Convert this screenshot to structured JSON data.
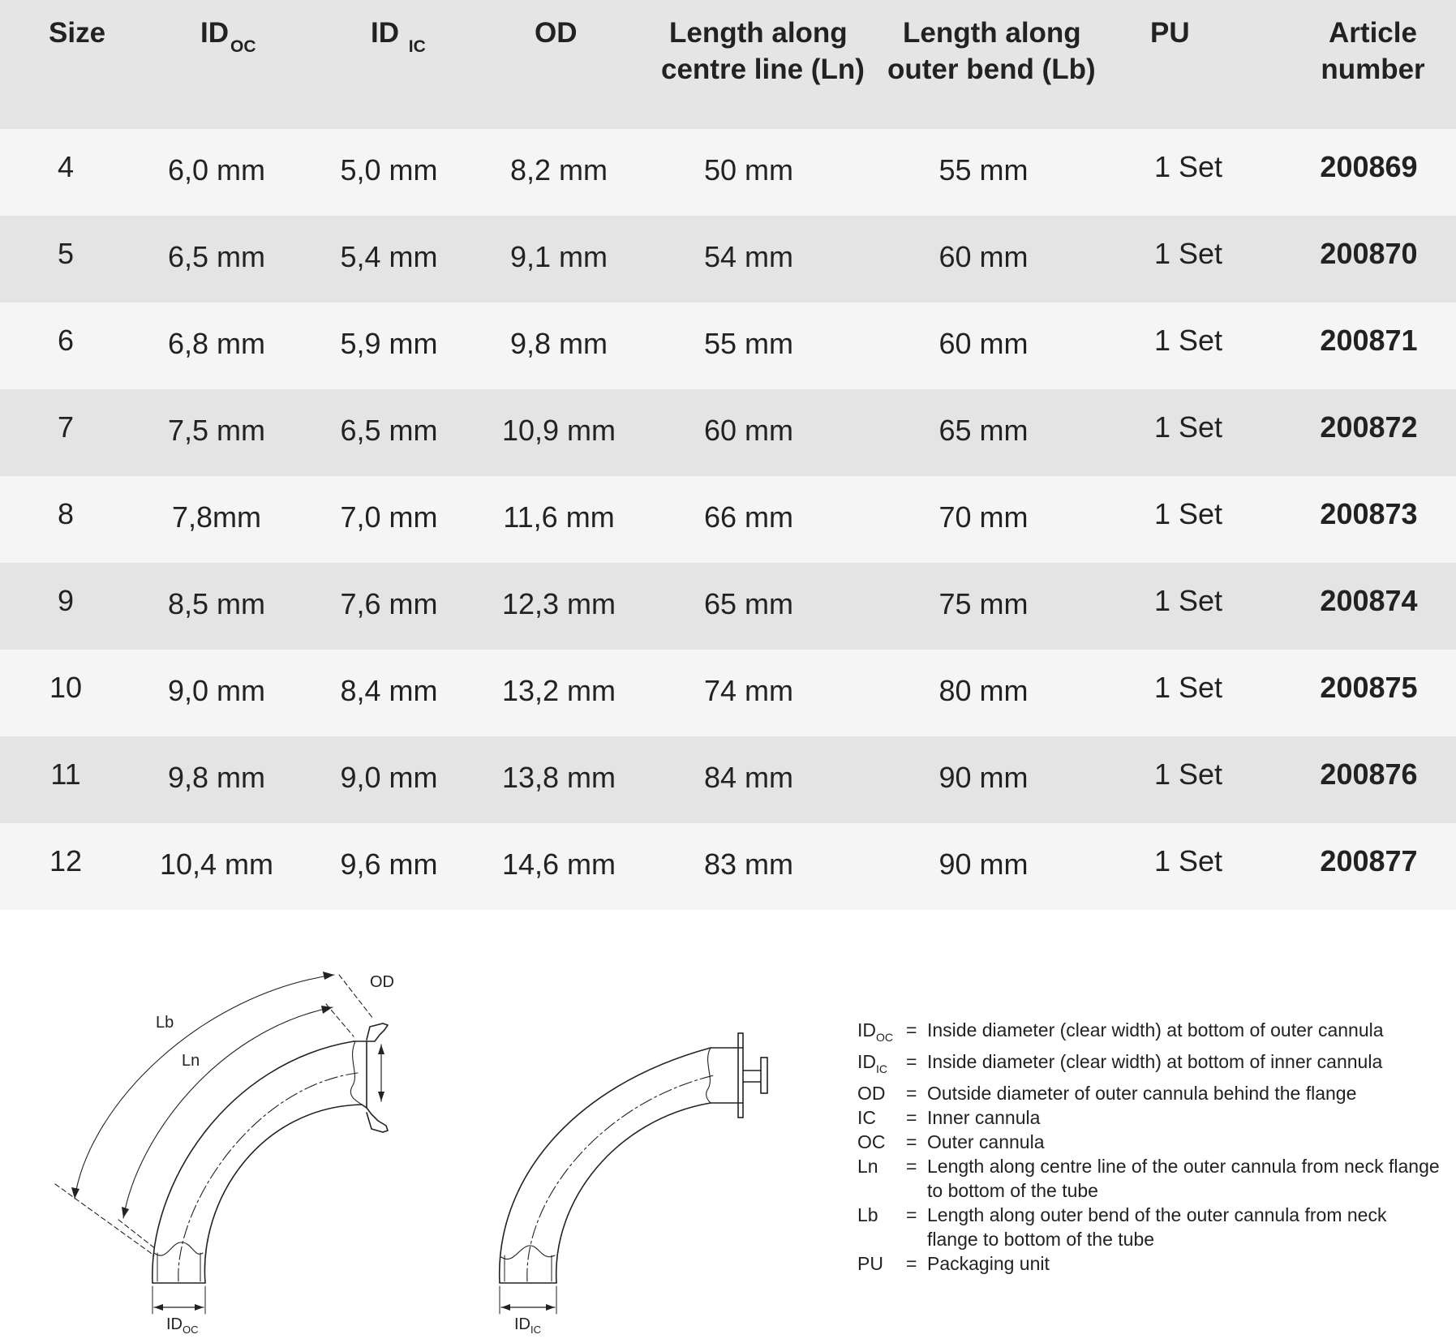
{
  "table": {
    "headers": {
      "size": "Size",
      "id_oc_main": "ID",
      "id_oc_sub": "OC",
      "id_ic_main": "ID",
      "id_ic_sub": "IC",
      "od": "OD",
      "ln_line1": "Length along",
      "ln_line2": "centre line (Ln)",
      "lb_line1": "Length along",
      "lb_line2": "outer bend (Lb)",
      "pu": "PU",
      "article_line1": "Article",
      "article_line2": "number"
    },
    "rows": [
      [
        "4",
        "6,0 mm",
        "5,0 mm",
        "8,2 mm",
        "50 mm",
        "55 mm",
        "1 Set",
        "200869"
      ],
      [
        "5",
        "6,5 mm",
        "5,4 mm",
        "9,1 mm",
        "54 mm",
        "60 mm",
        "1 Set",
        "200870"
      ],
      [
        "6",
        "6,8 mm",
        "5,9 mm",
        "9,8 mm",
        "55 mm",
        "60 mm",
        "1 Set",
        "200871"
      ],
      [
        "7",
        "7,5 mm",
        "6,5 mm",
        "10,9 mm",
        "60 mm",
        "65 mm",
        "1 Set",
        "200872"
      ],
      [
        "8",
        "7,8mm",
        "7,0 mm",
        "11,6 mm",
        "66 mm",
        "70 mm",
        "1 Set",
        "200873"
      ],
      [
        "9",
        "8,5 mm",
        "7,6 mm",
        "12,3 mm",
        "65 mm",
        "75 mm",
        "1 Set",
        "200874"
      ],
      [
        "10",
        "9,0 mm",
        "8,4 mm",
        "13,2 mm",
        "74 mm",
        "80 mm",
        "1 Set",
        "200875"
      ],
      [
        "11",
        "9,8 mm",
        "9,0 mm",
        "13,8 mm",
        "84 mm",
        "90 mm",
        "1 Set",
        "200876"
      ],
      [
        "12",
        "10,4 mm",
        "9,6 mm",
        "14,6 mm",
        "83 mm",
        "90 mm",
        "1 Set",
        "200877"
      ]
    ]
  },
  "figures": {
    "outer": {
      "lb": "Lb",
      "ln": "Ln",
      "od": "OD",
      "id_main": "ID",
      "id_sub": "OC"
    },
    "inner": {
      "id_main": "ID",
      "id_sub": "IC"
    }
  },
  "legend": [
    {
      "term": "ID",
      "term_sub": "OC",
      "eq": "=",
      "def": "Inside diameter (clear width) at bottom of outer cannula"
    },
    {
      "term": "ID",
      "term_sub": "IC",
      "eq": "=",
      "def": "Inside diameter (clear width) at bottom of inner cannula"
    },
    {
      "term": "OD",
      "term_sub": "",
      "eq": "=",
      "def": "Outside diameter of outer cannula behind the flange"
    },
    {
      "term": "IC",
      "term_sub": "",
      "eq": "=",
      "def": "Inner cannula"
    },
    {
      "term": "OC",
      "term_sub": "",
      "eq": "=",
      "def": "Outer cannula"
    },
    {
      "term": "Ln",
      "term_sub": "",
      "eq": "=",
      "def": "Length along centre line of the outer cannula from neck flange to bottom of the tube"
    },
    {
      "term": "Lb",
      "term_sub": "",
      "eq": "=",
      "def": "Length along outer bend of the outer cannula from neck flange to bottom of the tube"
    },
    {
      "term": "PU",
      "term_sub": "",
      "eq": "=",
      "def": "Packaging unit"
    }
  ]
}
